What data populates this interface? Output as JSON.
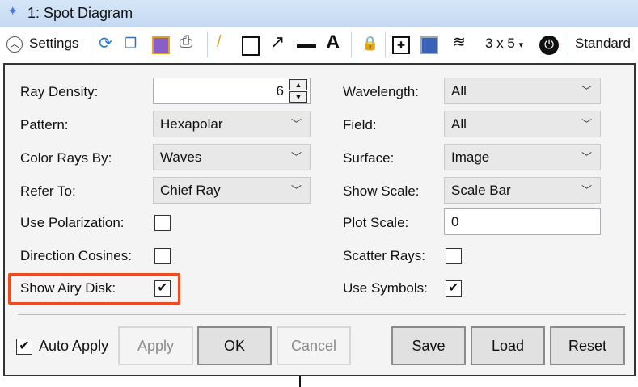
{
  "window": {
    "title": "1: Spot Diagram"
  },
  "toolbar": {
    "settings": "Settings",
    "layout": "3 x 5",
    "standard": "Standard"
  },
  "left": [
    {
      "label": "Ray Density:",
      "type": "spin",
      "value": "6"
    },
    {
      "label": "Pattern:",
      "type": "select",
      "value": "Hexapolar"
    },
    {
      "label": "Color Rays By:",
      "type": "select",
      "value": "Waves"
    },
    {
      "label": "Refer To:",
      "type": "select",
      "value": "Chief Ray"
    },
    {
      "label": "Use Polarization:",
      "type": "check",
      "checked": false
    },
    {
      "label": "Direction Cosines:",
      "type": "check",
      "checked": false
    },
    {
      "label": "Show Airy Disk:",
      "type": "check",
      "checked": true
    }
  ],
  "right": [
    {
      "label": "Wavelength:",
      "type": "select",
      "value": "All"
    },
    {
      "label": "Field:",
      "type": "select",
      "value": "All"
    },
    {
      "label": "Surface:",
      "type": "select",
      "value": "Image"
    },
    {
      "label": "Show Scale:",
      "type": "select",
      "value": "Scale Bar"
    },
    {
      "label": "Plot Scale:",
      "type": "text",
      "value": "0"
    },
    {
      "label": "Scatter Rays:",
      "type": "check",
      "checked": false
    },
    {
      "label": "Use Symbols:",
      "type": "check",
      "checked": true
    }
  ],
  "footer": {
    "auto_apply": "Auto Apply",
    "auto_apply_checked": true,
    "apply": "Apply",
    "ok": "OK",
    "cancel": "Cancel",
    "save": "Save",
    "load": "Load",
    "reset": "Reset"
  },
  "colors": {
    "highlight": "#f04a1f",
    "title_bar": "#c4d9f2"
  }
}
